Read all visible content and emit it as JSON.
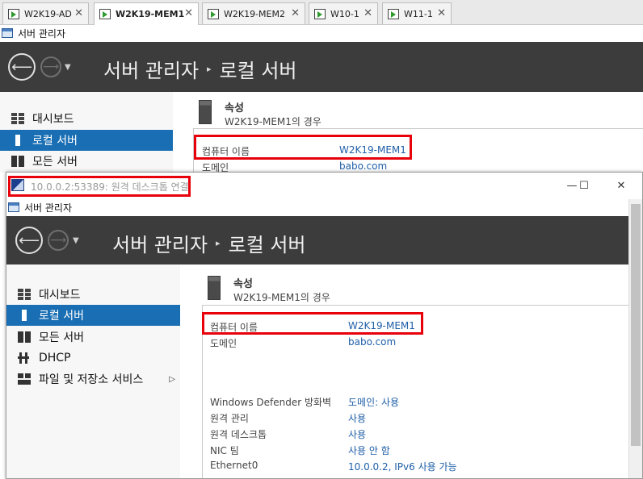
{
  "vm_tabs": [
    {
      "label": "W2K19-AD",
      "active": false
    },
    {
      "label": "W2K19-MEM1",
      "active": true
    },
    {
      "label": "W2K19-MEM2",
      "active": false
    },
    {
      "label": "W10-1",
      "active": false
    },
    {
      "label": "W11-1",
      "active": false
    }
  ],
  "close_glyph": "✕",
  "server_manager": {
    "app_title": "서버 관리자",
    "breadcrumb_root": "서버 관리자",
    "breadcrumb_sep": "▸",
    "breadcrumb_current": "로컬 서버",
    "nav_drop": "▼",
    "sidebar": [
      {
        "label": "대시보드",
        "icon": "dashboard-icon"
      },
      {
        "label": "로컬 서버",
        "icon": "server-icon"
      },
      {
        "label": "모든 서버",
        "icon": "servers-icon"
      },
      {
        "label": "DHCP",
        "icon": "dhcp-icon"
      },
      {
        "label": "파일 및 저장소 서비스",
        "icon": "storage-icon"
      }
    ],
    "expander_glyph": "▷",
    "properties_title": "속성",
    "properties_subtitle": "W2K19-MEM1의 경우",
    "properties": [
      {
        "label": "컴퓨터 이름",
        "value": "W2K19-MEM1"
      },
      {
        "label": "도메인",
        "value": "babo.com"
      },
      {
        "label": "Windows Defender 방화벽",
        "value": "도메인: 사용"
      },
      {
        "label": "원격 관리",
        "value": "사용"
      },
      {
        "label": "원격 데스크톱",
        "value": "사용"
      },
      {
        "label": "NIC 팀",
        "value": "사용 안 함"
      },
      {
        "label": "Ethernet0",
        "value": "10.0.0.2, IPv6 사용 가능"
      }
    ]
  },
  "rdp_window": {
    "title": "10.0.0.2:53389: 원격 데스크톱 연결",
    "minimize": "—",
    "maximize": "☐",
    "close": "✕"
  },
  "colors": {
    "highlight": "#e8000b",
    "selected": "#1a6fb4",
    "header": "#3c3c3c",
    "link": "#1f5fa8"
  }
}
